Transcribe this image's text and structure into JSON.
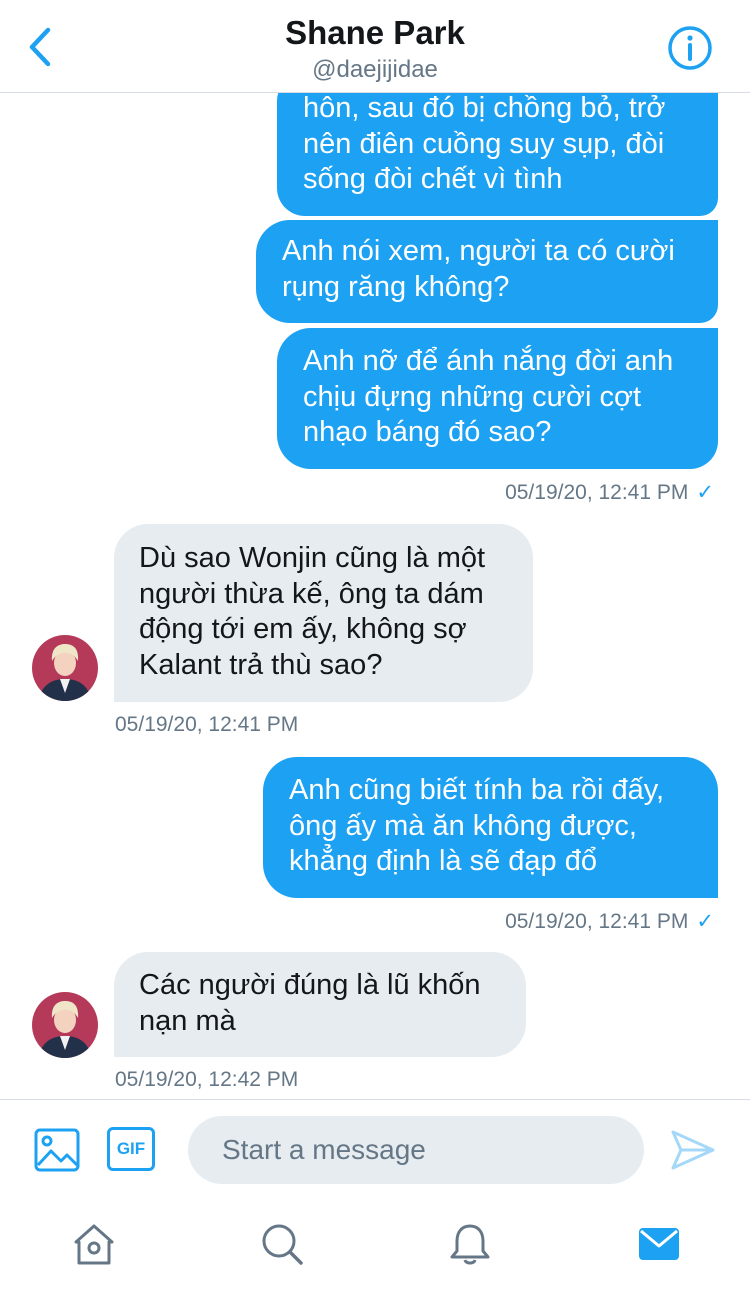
{
  "header": {
    "title": "Shane Park",
    "handle": "@daejijidae",
    "back_icon": "chevron-left-icon",
    "info_icon": "info-icon"
  },
  "messages": [
    {
      "direction": "sent",
      "lines": [
        "hôn, sau đó bị chồng bỏ, trở",
        "nên điên cuồng suy sụp, đòi",
        "sống đòi chết vì tình"
      ]
    },
    {
      "direction": "sent",
      "lines": [
        "Anh nói xem, người ta có cười",
        "rụng răng không?"
      ]
    },
    {
      "direction": "sent",
      "lines": [
        "Anh nỡ để ánh nắng đời anh",
        "chịu đựng những cười cợt",
        "nhạo báng đó sao?"
      ],
      "timestamp": "05/19/20, 12:41 PM",
      "status": "✓"
    },
    {
      "direction": "received",
      "lines": [
        "Dù sao Wonjin cũng là một",
        "người thừa kế, ông ta dám",
        "động tới em ấy, không sợ",
        "Kalant trả thù sao?"
      ],
      "timestamp": "05/19/20, 12:41 PM"
    },
    {
      "direction": "sent",
      "lines": [
        "Anh cũng biết tính ba rồi đấy,",
        "ông ấy mà ăn không được,",
        "khẳng định là sẽ đạp đổ"
      ],
      "timestamp": "05/19/20, 12:41 PM",
      "status": "✓"
    },
    {
      "direction": "received",
      "lines": [
        "Các người đúng là lũ khốn",
        "nạn mà"
      ],
      "timestamp": "05/19/20, 12:42 PM"
    }
  ],
  "composer": {
    "placeholder": "Start a message",
    "gif_label": "GIF",
    "media_icon": "image-icon",
    "send_icon": "send-icon"
  },
  "tabbar": {
    "items": [
      "home-icon",
      "search-icon",
      "notifications-icon",
      "messages-icon"
    ],
    "active": "messages-icon"
  },
  "colors": {
    "accent": "#1da1f2",
    "received_bubble": "#e6ecf0",
    "text": "#14171a",
    "muted": "#657786"
  }
}
